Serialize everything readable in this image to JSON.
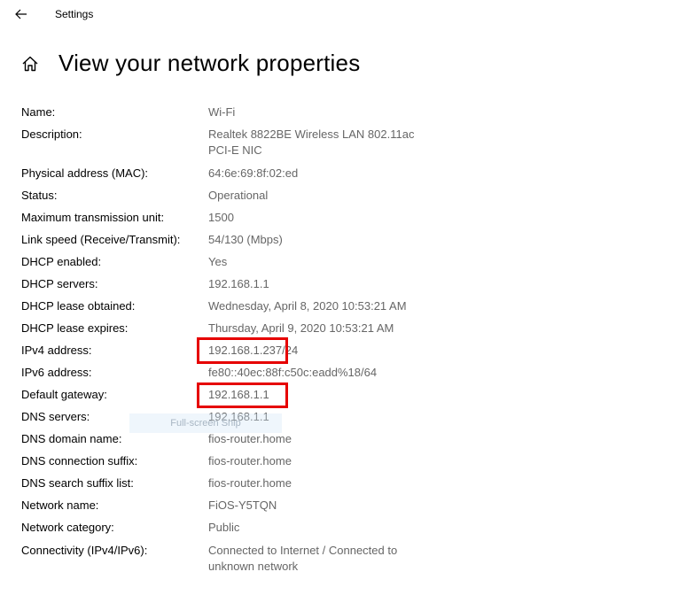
{
  "window": {
    "title": "Settings"
  },
  "page": {
    "title": "View your network properties"
  },
  "properties": [
    {
      "label": "Name:",
      "value": "Wi-Fi"
    },
    {
      "label": "Description:",
      "value": "Realtek 8822BE Wireless LAN 802.11ac PCI-E NIC"
    },
    {
      "label": "Physical address (MAC):",
      "value": "64:6e:69:8f:02:ed"
    },
    {
      "label": "Status:",
      "value": "Operational"
    },
    {
      "label": "Maximum transmission unit:",
      "value": "1500"
    },
    {
      "label": "Link speed (Receive/Transmit):",
      "value": "54/130 (Mbps)"
    },
    {
      "label": "DHCP enabled:",
      "value": "Yes"
    },
    {
      "label": "DHCP servers:",
      "value": "192.168.1.1"
    },
    {
      "label": "DHCP lease obtained:",
      "value": "Wednesday, April 8, 2020 10:53:21 AM"
    },
    {
      "label": "DHCP lease expires:",
      "value": "Thursday, April 9, 2020 10:53:21 AM"
    },
    {
      "label": "IPv4 address:",
      "value": "192.168.1.237/24"
    },
    {
      "label": "IPv6 address:",
      "value": "fe80::40ec:88f:c50c:eadd%18/64"
    },
    {
      "label": "Default gateway:",
      "value": "192.168.1.1"
    },
    {
      "label": "DNS servers:",
      "value": "192.168.1.1"
    },
    {
      "label": "DNS domain name:",
      "value": "fios-router.home"
    },
    {
      "label": "DNS connection suffix:",
      "value": "fios-router.home"
    },
    {
      "label": "DNS search suffix list:",
      "value": "fios-router.home"
    },
    {
      "label": "Network name:",
      "value": "FiOS-Y5TQN"
    },
    {
      "label": "Network category:",
      "value": "Public"
    },
    {
      "label": "Connectivity (IPv4/IPv6):",
      "value": "Connected to Internet / Connected to unknown network"
    }
  ],
  "overlay": {
    "fullscreen_tip": "Full-screen Snip",
    "highlight_color": "#e60000"
  }
}
